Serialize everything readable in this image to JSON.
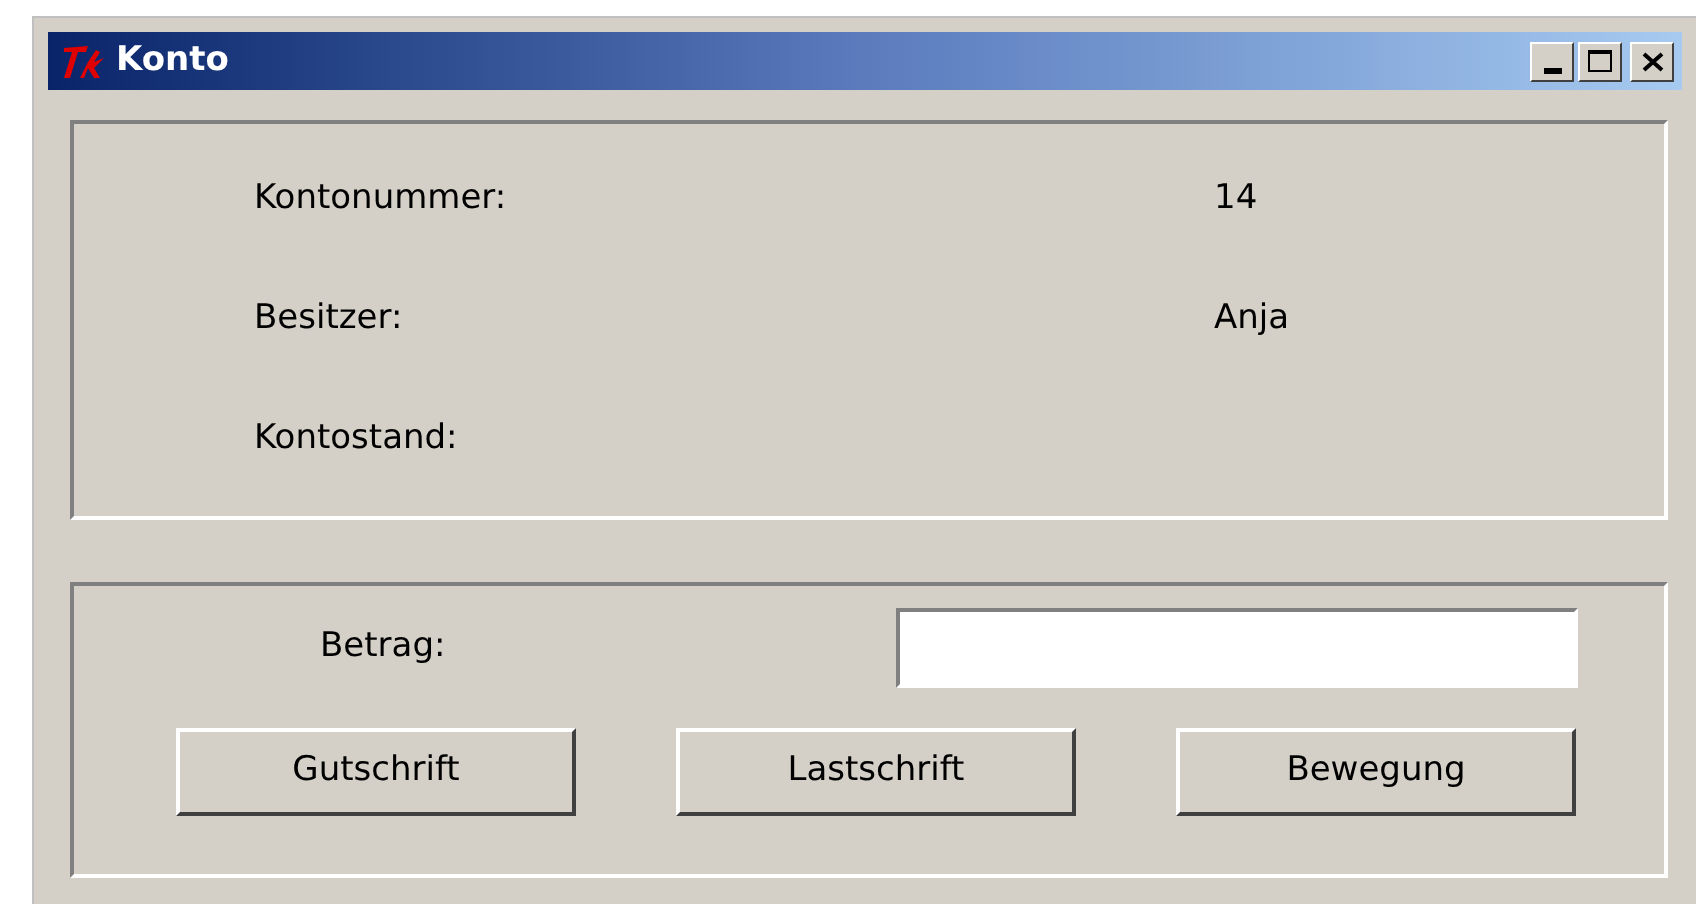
{
  "window": {
    "title": "Konto"
  },
  "info_rows": [
    {
      "label": "Kontonummer:",
      "value": "14"
    },
    {
      "label": "Besitzer:",
      "value": "Anja"
    },
    {
      "label": "Kontostand:"
    }
  ],
  "amount": {
    "label": "Betrag:"
  },
  "buttons": [
    "Gutschrift",
    "Lastschrift",
    "Bewegung"
  ]
}
